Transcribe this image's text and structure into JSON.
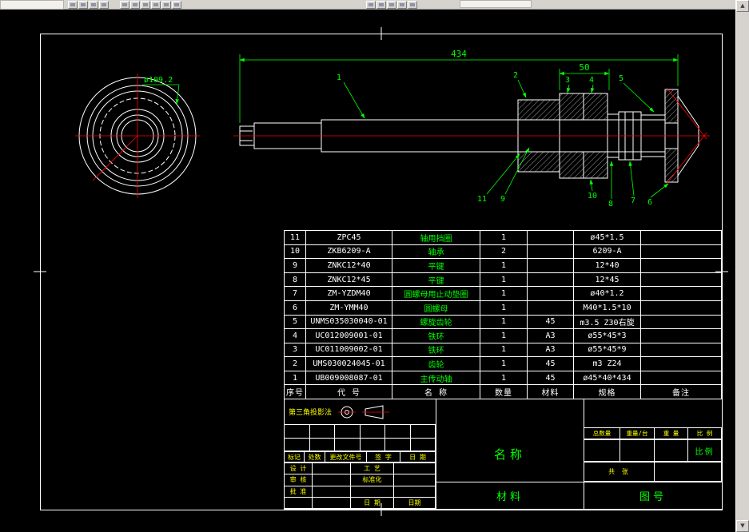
{
  "colors": {
    "background": "#000000",
    "line": "#ffffff",
    "dimension_green": "#00ff00",
    "centerline_red": "#ff0000",
    "annotation_yellow": "#ffff00",
    "chrome_gray": "#d6d3ce"
  },
  "scrollbar": {
    "up_icon": "▲",
    "down_icon": "▼"
  },
  "drawing": {
    "dia_label": "ø109.2",
    "dim_overall": "434",
    "dim_section": "50",
    "labels": [
      "1",
      "2",
      "3",
      "4",
      "5",
      "6",
      "7",
      "8",
      "9",
      "10",
      "11"
    ]
  },
  "bom": {
    "headers": [
      "序号",
      "代  号",
      "名  称",
      "数量",
      "材料",
      "规格",
      "备注"
    ],
    "rows": [
      {
        "no": "11",
        "code": "ZPC45",
        "name": "轴用挡圈",
        "qty": "1",
        "material": "",
        "spec": "ø45*1.5",
        "remark": ""
      },
      {
        "no": "10",
        "code": "ZKB6209-A",
        "name": "轴承",
        "qty": "2",
        "material": "",
        "spec": "6209-A",
        "remark": ""
      },
      {
        "no": "9",
        "code": "ZNKC12*40",
        "name": "平键",
        "qty": "1",
        "material": "",
        "spec": "12*40",
        "remark": ""
      },
      {
        "no": "8",
        "code": "ZNKC12*45",
        "name": "平键",
        "qty": "1",
        "material": "",
        "spec": "12*45",
        "remark": ""
      },
      {
        "no": "7",
        "code": "ZM-YZDM40",
        "name": "圆螺母用止动垫圈",
        "qty": "1",
        "material": "",
        "spec": "ø40*1.2",
        "remark": ""
      },
      {
        "no": "6",
        "code": "ZM-YMM40",
        "name": "圆螺母",
        "qty": "1",
        "material": "",
        "spec": "M40*1.5*10",
        "remark": ""
      },
      {
        "no": "5",
        "code": "UNMS035030040-01",
        "name": "螺旋齿轮",
        "qty": "1",
        "material": "45",
        "spec": "m3.5 Z30右旋",
        "remark": ""
      },
      {
        "no": "4",
        "code": "UC012009001-01",
        "name": "铁环",
        "qty": "1",
        "material": "A3",
        "spec": "ø55*45*3",
        "remark": ""
      },
      {
        "no": "3",
        "code": "UC011009002-01",
        "name": "铁环",
        "qty": "1",
        "material": "A3",
        "spec": "ø55*45*9",
        "remark": ""
      },
      {
        "no": "2",
        "code": "UMS030024045-01",
        "name": "齿轮",
        "qty": "1",
        "material": "45",
        "spec": "m3 Z24",
        "remark": ""
      },
      {
        "no": "1",
        "code": "UB009008087-01",
        "name": "主传动轴",
        "qty": "1",
        "material": "45",
        "spec": "ø45*40*434",
        "remark": ""
      }
    ]
  },
  "title_block": {
    "projection": "第三角投影法",
    "revision_headers": [
      "标记",
      "处数",
      "更改文件号",
      "签 字",
      "日 期"
    ],
    "roles": [
      [
        "设 计",
        "",
        "工 艺",
        ""
      ],
      [
        "审 核",
        "",
        "标准化",
        ""
      ],
      [
        "批 准",
        "",
        "",
        ""
      ],
      [
        "",
        "",
        "日 期",
        "日期"
      ]
    ],
    "name_label": "名称",
    "material_label": "材料",
    "drawing_no_label": "图号",
    "right_headers": [
      "总数量",
      "重量/台",
      "重 量",
      "比 例"
    ],
    "scale_value": "比例",
    "sheet_label": "共  张"
  }
}
